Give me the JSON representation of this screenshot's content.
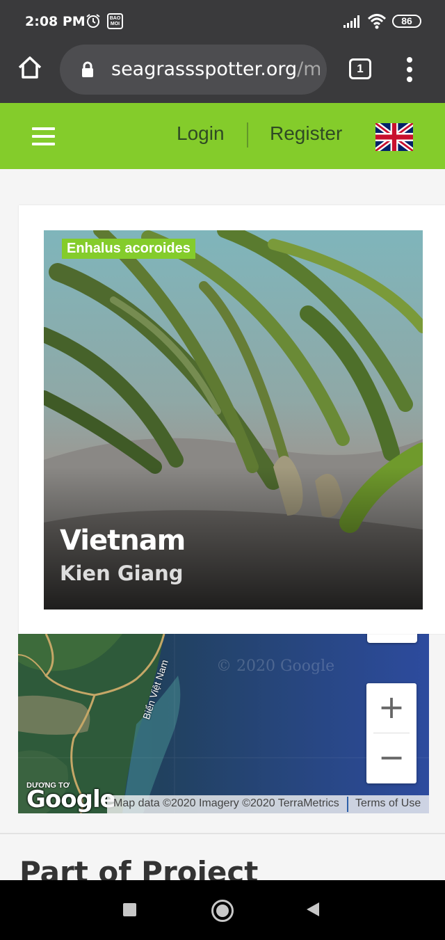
{
  "status_bar": {
    "time": "2:08 PM",
    "notification_app": "BAO MOI",
    "battery": "86",
    "icons": [
      "alarm-icon",
      "signal-icon",
      "wifi-icon",
      "battery-icon"
    ]
  },
  "browser": {
    "url": "seagrassspotter.org",
    "url_tail": "/ma",
    "tab_count": "1"
  },
  "site_header": {
    "login_label": "Login",
    "register_label": "Register",
    "language_flag": "uk-flag-icon",
    "accent_color": "#84cc2b"
  },
  "card": {
    "species_tag": "Enhalus acoroides",
    "country": "Vietnam",
    "region": "Kien Giang"
  },
  "map": {
    "watermark": "© 2020 Google",
    "sea_label": "Biển Việt Nam",
    "place_label": "DƯƠNG TƠ",
    "zoom_in_label": "+",
    "zoom_out_label": "−",
    "google_logo": "Google",
    "attribution": "Map data ©2020 Imagery ©2020 TerraMetrics",
    "terms_label": "Terms of Use"
  },
  "section": {
    "project_heading": "Part of Project"
  }
}
